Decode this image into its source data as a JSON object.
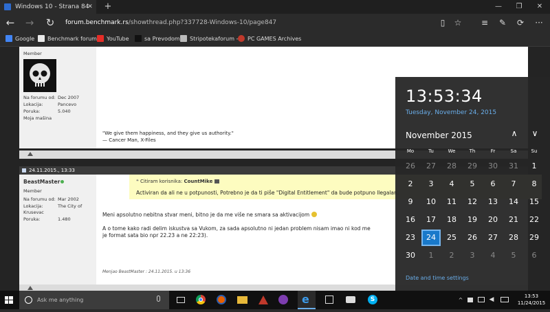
{
  "browser": {
    "tab_title": "Windows 10 - Strana 84",
    "tab_close": "✕",
    "new_tab": "+",
    "win_min": "—",
    "win_max": "❐",
    "win_close": "✕",
    "url_domain": "forum.benchmark.rs",
    "url_path": "/showthread.php?337728-Windows-10/page847",
    "back": "←",
    "forward": "→",
    "refresh": "↻",
    "reading": "▯",
    "favorite_star": "☆",
    "hub": "≡",
    "note": "✎",
    "share": "⟳",
    "more": "···"
  },
  "favorites": [
    {
      "label": "Google",
      "color": "#4285f4"
    },
    {
      "label": "Benchmark forum",
      "color": "#e8e8e8"
    },
    {
      "label": "YouTube",
      "color": "#e52d27"
    },
    {
      "label": "sa Prevodom",
      "color": "#222"
    },
    {
      "label": "Stripotekaforum -",
      "color": "#bbb"
    },
    {
      "label": "PC GAMES Archives",
      "color": "#c0392b"
    }
  ],
  "post1": {
    "role": "Member",
    "info": [
      [
        "Na forumu od:",
        "Dec 2007"
      ],
      [
        "Lokacija:",
        "Pancevo"
      ],
      [
        "Poruka:",
        "5.040"
      ],
      [
        "Moja mašina",
        ""
      ]
    ],
    "signature_1": "\"We give them happiness, and they give us authority.\"",
    "signature_2": "— Cancer Man, X-Files"
  },
  "post2": {
    "date": "24.11.2015., 13:33",
    "username": "BeastMaster",
    "role": "Member",
    "info": [
      [
        "Na forumu od:",
        "Mar 2002"
      ],
      [
        "Lokacija:",
        "The City of"
      ],
      [
        "",
        "Krusevac"
      ],
      [
        "Poruka:",
        "1.480"
      ]
    ],
    "quote_header": "Citiram korisnika: ",
    "quote_user": "CountMike",
    "quote_text": "Activiran da ali ne u potpunosti, Potrebno je da ti piše \"Digital Entitlement\" da bude potpuno llegalan.",
    "body_1": "Meni apsolutno nebitna stvar meni, bitno je da me više ne smara sa aktivacijom",
    "body_2": "A o tome kako radi delim iskustva sa Vukom, za sada apsolutno ni jedan problem nisam imao ni kod me",
    "body_3": "je format sata bio npr 22.23 a ne 22:23).",
    "edited": "Menjao BeastMaster : 24.11.2015. u 13:36"
  },
  "calendar": {
    "time": "13:53:34",
    "date_long": "Tuesday, November 24, 2015",
    "month": "November 2015",
    "prev": "∧",
    "next": "∨",
    "weekdays": [
      "Mo",
      "Tu",
      "We",
      "Th",
      "Fr",
      "Sa",
      "Su"
    ],
    "weeks": [
      [
        "26",
        "27",
        "28",
        "29",
        "30",
        "31",
        "1"
      ],
      [
        "2",
        "3",
        "4",
        "5",
        "6",
        "7",
        "8"
      ],
      [
        "9",
        "10",
        "11",
        "12",
        "13",
        "14",
        "15"
      ],
      [
        "16",
        "17",
        "18",
        "19",
        "20",
        "21",
        "22"
      ],
      [
        "23",
        "24",
        "25",
        "26",
        "27",
        "28",
        "29"
      ],
      [
        "30",
        "1",
        "2",
        "3",
        "4",
        "5",
        "6"
      ]
    ],
    "today": "24",
    "settings_link": "Date and time settings",
    "colors": {
      "accent": "#1979ca",
      "link": "#6aaeea"
    }
  },
  "taskbar": {
    "search_placeholder": "Ask me anything",
    "clock_time": "13:53",
    "clock_date": "11/24/2015"
  }
}
